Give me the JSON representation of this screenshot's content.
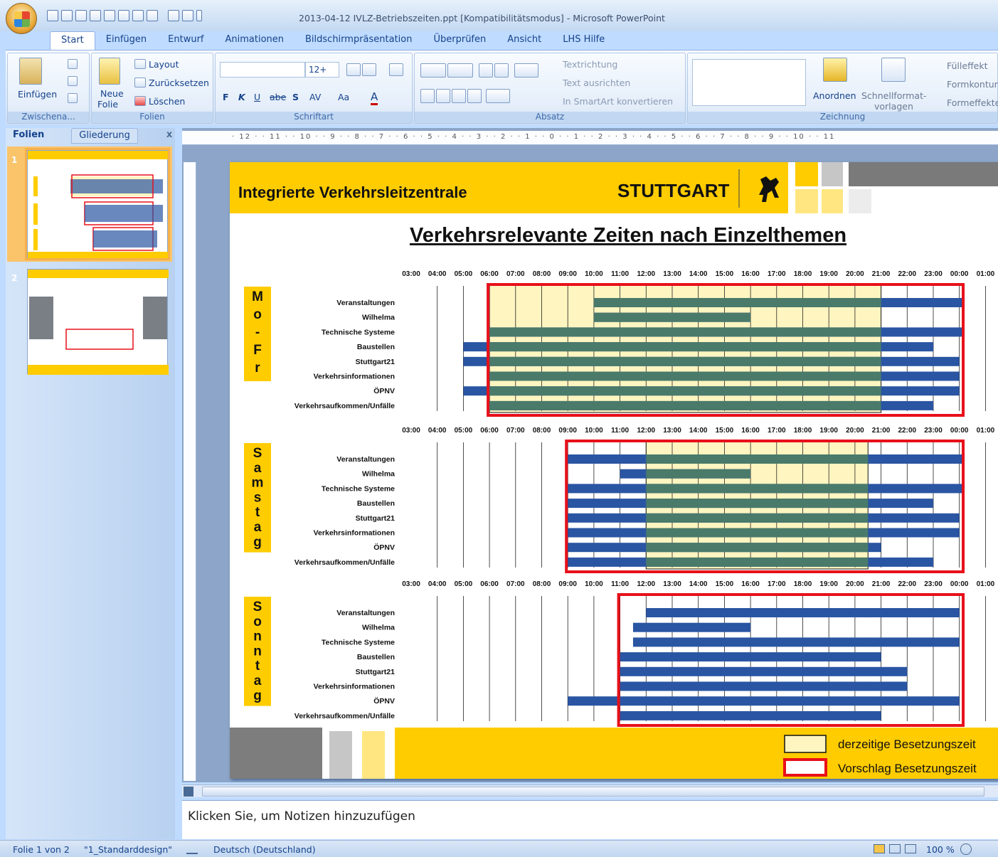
{
  "window": {
    "title": "2013-04-12 IVLZ-Betriebszeiten.ppt [Kompatibilitätsmodus] - Microsoft PowerPoint"
  },
  "tabs": [
    "Start",
    "Einfügen",
    "Entwurf",
    "Animationen",
    "Bildschirmpräsentation",
    "Überprüfen",
    "Ansicht",
    "LHS Hilfe"
  ],
  "ribbon": {
    "clipboard": {
      "paste": "Einfügen",
      "label": "Zwischena..."
    },
    "slides": {
      "new_slide_1": "Neue",
      "new_slide_2": "Folie",
      "layout": "Layout",
      "reset": "Zurücksetzen",
      "delete": "Löschen",
      "label": "Folien"
    },
    "font": {
      "size": "12+",
      "bold": "F",
      "italic": "K",
      "underline": "U",
      "strike": "abe",
      "shadow": "S",
      "spacing": "AV",
      "case": "Aa",
      "color": "A",
      "label": "Schriftart"
    },
    "paragraph": {
      "text_direction": "Textrichtung",
      "align_text": "Text ausrichten",
      "smartart": "In SmartArt konvertieren",
      "label": "Absatz"
    },
    "drawing": {
      "arrange": "Anordnen",
      "quick_styles_1": "Schnellformat-",
      "quick_styles_2": "vorlagen",
      "fill": "Fülleffekt",
      "outline": "Formkontur",
      "effects": "Formeffekte",
      "label": "Zeichnung"
    }
  },
  "panel": {
    "tab_slides": "Folien",
    "tab_outline": "Gliederung",
    "close": "x",
    "slide_numbers": [
      "1",
      "2"
    ]
  },
  "slide": {
    "header": "Integrierte Verkehrsleitzentrale",
    "brand": "STUTTGART",
    "title": "Verkehrsrelevante Zeiten nach Einzelthemen",
    "times": [
      "03:00",
      "04:00",
      "05:00",
      "06:00",
      "07:00",
      "08:00",
      "09:00",
      "10:00",
      "11:00",
      "12:00",
      "13:00",
      "14:00",
      "15:00",
      "16:00",
      "17:00",
      "18:00",
      "19:00",
      "20:00",
      "21:00",
      "22:00",
      "23:00",
      "00:00",
      "01:00"
    ],
    "topics": [
      "Veranstaltungen",
      "Wilhelma",
      "Technische Systeme",
      "Baustellen",
      "Stuttgart21",
      "Verkehrsinformationen",
      "ÖPNV",
      "Verkehrsaufkommen/Unfälle"
    ],
    "blocks": [
      {
        "day": "Mo-Fr",
        "letters": [
          "M",
          "o",
          "-",
          "F",
          "r"
        ],
        "current": [
          6,
          21
        ],
        "proposal": [
          6,
          24.2
        ],
        "bars": [
          [
            10,
            24.2
          ],
          [
            10,
            16
          ],
          [
            6,
            24.2
          ],
          [
            5,
            23
          ],
          [
            5,
            24
          ],
          [
            6,
            24
          ],
          [
            5,
            24
          ],
          [
            6,
            23
          ]
        ]
      },
      {
        "day": "Samstag",
        "letters": [
          "S",
          "a",
          "m",
          "s",
          "t",
          "a",
          "g"
        ],
        "current": [
          12,
          20.5
        ],
        "proposal": [
          9,
          24.2
        ],
        "bars": [
          [
            9,
            24.2
          ],
          [
            11,
            16
          ],
          [
            9,
            24.2
          ],
          [
            9,
            23
          ],
          [
            9,
            24
          ],
          [
            9,
            24
          ],
          [
            9,
            21
          ],
          [
            9,
            23
          ]
        ]
      },
      {
        "day": "Sonntag",
        "letters": [
          "S",
          "o",
          "n",
          "n",
          "t",
          "a",
          "g"
        ],
        "current": null,
        "proposal": [
          11,
          24.2
        ],
        "bars": [
          [
            12,
            24
          ],
          [
            11.5,
            16
          ],
          [
            11.5,
            24
          ],
          [
            11,
            21
          ],
          [
            11,
            22
          ],
          [
            11,
            22
          ],
          [
            9,
            24
          ],
          [
            11,
            21
          ]
        ]
      }
    ],
    "legend": {
      "current": "derzeitige Besetzungszeit",
      "proposal": "Vorschlag Besetzungszeit"
    },
    "colors": {
      "yellow": "#ffcc00",
      "current_fill": "#fff5c0",
      "bar": "#2a55a3",
      "overlap": "#4a7a6a",
      "proposal_border": "#e8101a"
    }
  },
  "ruler": {
    "h_labels": "· 12 · · 11 · · 10 · · 9 · · 8 · · 7 · · 6 · · 5 · · 4 · · 3 · · 2 · · 1 · · 0 · · 1 · · 2 · · 3 · · 4 · · 5 · · 6 · · 7 · · 8 · · 9 · · 10 · · 11"
  },
  "notes": {
    "placeholder": "Klicken Sie, um Notizen hinzuzufügen"
  },
  "status": {
    "slide": "Folie 1 von 2",
    "theme": "\"1_Standarddesign\"",
    "language": "Deutsch (Deutschland)",
    "zoom": "100 %"
  }
}
